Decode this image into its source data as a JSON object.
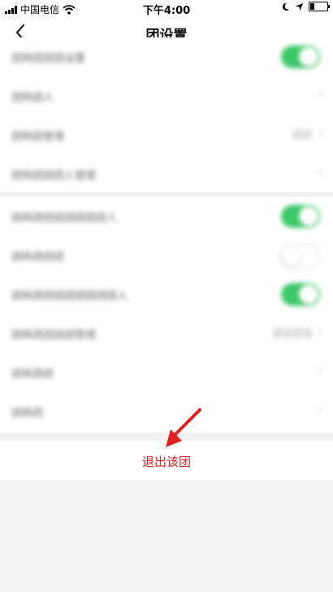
{
  "status_bar": {
    "carrier": "中国电信",
    "time": "下午4:00",
    "battery_level": 0.25
  },
  "nav": {
    "title": "团设置",
    "back_icon": "chevron-left-icon"
  },
  "settings_group_1": [
    {
      "label": "团购团团团设置",
      "control": "toggle",
      "on": true
    },
    {
      "label": "团购团人",
      "control": "chevron"
    },
    {
      "label": "团购团管理",
      "control": "value",
      "value": "团团"
    },
    {
      "label": "团购团团团人管理",
      "control": "chevron"
    }
  ],
  "settings_group_2": [
    {
      "label": "团购团团团团团团团人",
      "control": "toggle",
      "on": true
    },
    {
      "label": "团购团团团",
      "control": "toggle",
      "on": false
    },
    {
      "label": "团购团团团团团团团团人",
      "control": "toggle",
      "on": true
    },
    {
      "label": "团购团团团团管理",
      "control": "value",
      "value": "团团团团"
    },
    {
      "label": "团购团团",
      "control": "chevron"
    },
    {
      "label": "团购团",
      "control": "chevron"
    }
  ],
  "exit_label": "退出该团",
  "colors": {
    "exit_red": "#e02020",
    "toggle_green": "#3cc86a",
    "arrow_red": "#e02020"
  }
}
